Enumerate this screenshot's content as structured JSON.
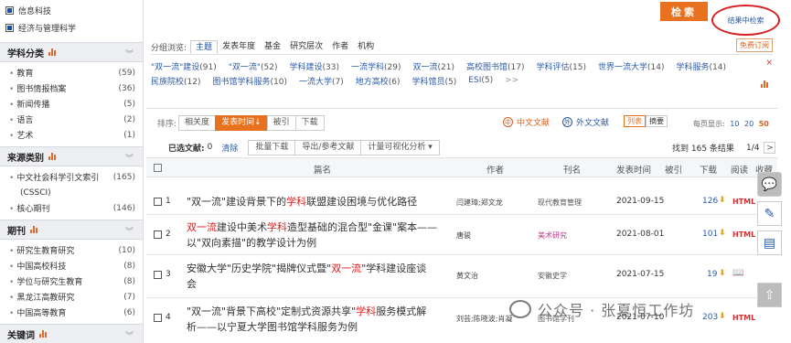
{
  "sidebar": {
    "top_checks": [
      "信息科技",
      "经济与管理科学"
    ],
    "sections": [
      {
        "title": "学科分类",
        "items": [
          {
            "name": "教育",
            "count": "(59)"
          },
          {
            "name": "图书情报档案",
            "count": "(36)"
          },
          {
            "name": "新闻传播",
            "count": "(5)"
          },
          {
            "name": "语言",
            "count": "(2)"
          },
          {
            "name": "艺术",
            "count": "(1)"
          }
        ]
      },
      {
        "title": "来源类别",
        "items": [
          {
            "name": "中文社会科学引文索引",
            "count": "(165)"
          },
          {
            "name": "(CSSCI)",
            "count": ""
          },
          {
            "name": "核心期刊",
            "count": "(146)"
          }
        ]
      },
      {
        "title": "期刊",
        "items": [
          {
            "name": "研究生教育研究",
            "count": "(10)"
          },
          {
            "name": "中国高校科技",
            "count": "(8)"
          },
          {
            "name": "学位与研究生教育",
            "count": "(8)"
          },
          {
            "name": "黑龙江高教研究",
            "count": "(7)"
          },
          {
            "name": "中国高等教育",
            "count": "(6)"
          }
        ]
      },
      {
        "title": "关键词",
        "items": []
      }
    ]
  },
  "search": {
    "button": "检索",
    "within_results": "结果中检索"
  },
  "grouping": {
    "label": "分组浏览:",
    "tabs": [
      "主题",
      "发表年度",
      "基金",
      "研究层次",
      "作者",
      "机构"
    ],
    "free_subscribe": "免费订阅"
  },
  "tags": {
    "row1": [
      {
        "t": "\"双一流\"建设",
        "n": "(91)"
      },
      {
        "t": "\"双一流\"",
        "n": "(52)"
      },
      {
        "t": "学科建设",
        "n": "(33)"
      },
      {
        "t": "一流学科",
        "n": "(29)"
      },
      {
        "t": "双一流",
        "n": "(21)"
      },
      {
        "t": "高校图书馆",
        "n": "(17)"
      },
      {
        "t": "学科评估",
        "n": "(15)"
      },
      {
        "t": "世界一流大学",
        "n": "(14)"
      },
      {
        "t": "学科服务",
        "n": "(14)"
      }
    ],
    "row2": [
      {
        "t": "民族院校",
        "n": "(12)"
      },
      {
        "t": "图书馆学科服务",
        "n": "(10)"
      },
      {
        "t": "一流大学",
        "n": "(7)"
      },
      {
        "t": "地方高校",
        "n": "(6)"
      },
      {
        "t": "学科馆员",
        "n": "(5)"
      },
      {
        "t": "ESI",
        "n": "(5)"
      },
      {
        "t": ">>",
        "n": ""
      }
    ],
    "close": "×"
  },
  "sort": {
    "label": "排序:",
    "options": [
      "相关度",
      "发表时间↓",
      "被引",
      "下载"
    ],
    "chinese": "中文文献",
    "foreign": "外文文献",
    "view_list": "列表",
    "view_abstract": "摘要",
    "per_page_label": "每页显示:",
    "per_page": [
      "10",
      "20",
      "50"
    ]
  },
  "toolbar": {
    "selected_label": "已选文献:",
    "selected_count": "0",
    "clear": "清除",
    "buttons": [
      "批量下载",
      "导出/参考文献",
      "计量可视化分析 ▾"
    ],
    "found": "找到 165 条结果",
    "pager": "1/4",
    "next": ">"
  },
  "table": {
    "headers": {
      "title": "篇名",
      "author": "作者",
      "journal": "刊名",
      "date": "发表时间",
      "cited": "被引",
      "download": "下载",
      "read": "阅读",
      "collect": "收藏"
    },
    "rows": [
      {
        "idx": "1",
        "t1": "\"双一流\"建设背景下的",
        "t1hl": "学科",
        "t1b": "联盟建设困境与优化路径",
        "t2": "",
        "author": "闫建璋;郑文龙",
        "journal": "现代教育管理",
        "date": "2021-09-15",
        "dl": "126",
        "read": "HTML"
      },
      {
        "idx": "2",
        "t1pre": "",
        "t1hl0": "双一流",
        "t1": "建设中美术",
        "t1hl": "学科",
        "t1b": "造型基础的混合型\"金课\"案本——",
        "t2": "以\"双向素描\"的教学设计为例",
        "author": "唐骏",
        "journal": "美术研究",
        "date": "2021-08-01",
        "dl": "101",
        "read": "HTML"
      },
      {
        "idx": "3",
        "t1": "安徽大学\"历史学院\"揭牌仪式暨\"",
        "t1hl": "双一流",
        "t1b": "\"学科建设座谈",
        "t2": "会",
        "author": "黄文治",
        "journal": "安徽史学",
        "date": "2021-07-15",
        "dl": "19",
        "read": "📖"
      },
      {
        "idx": "4",
        "t1": "\"双一流\"背景下高校\"定制式资源共享\"",
        "t1hl": "学科",
        "t1b": "服务模式解",
        "t2": "析——以宁夏大学图书馆学科服务为例",
        "author": "刘芸;陈晓波;肖凝",
        "journal": "图书馆学刊",
        "date": "2021-07-10",
        "dl": "203",
        "read": "HTML"
      }
    ]
  },
  "watermark": "公众号 · 张夏恒工作坊"
}
